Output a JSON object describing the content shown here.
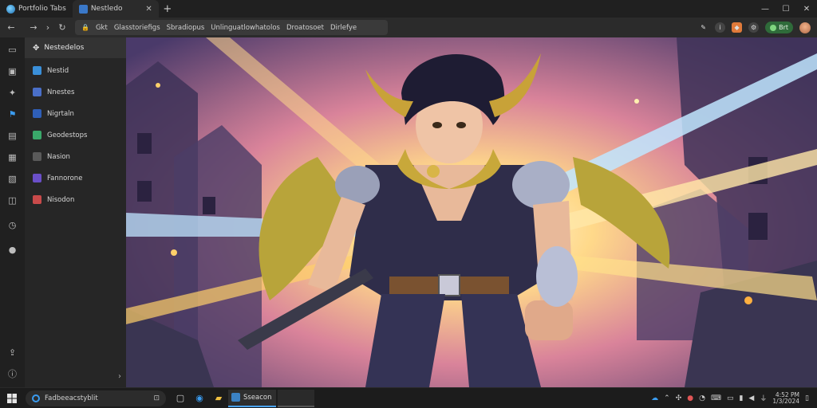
{
  "browser": {
    "tabs": [
      {
        "label": "Portfolio Tabs",
        "icon": "browser-logo-icon"
      },
      {
        "label": "Nestledo",
        "icon": "page-icon",
        "active": true
      }
    ],
    "new_tab_label": "+",
    "address": {
      "segment1": "Gkt",
      "segment2": "Glasstoriefigs",
      "segment3": "Sbradiopus",
      "segment4": "Unlinguatlowhatolos",
      "segment5": "Droatosoet",
      "segment6": "Dirlefye"
    },
    "profile_pill_label": "Brt"
  },
  "sidebar": {
    "header": "Nestedelos",
    "items": [
      {
        "label": "Nestid",
        "color": "#3a8fd9"
      },
      {
        "label": "Nnestes",
        "color": "#4a6fc8"
      },
      {
        "label": "Nigrtaln",
        "color": "#2f5fb8"
      },
      {
        "label": "Geodestops",
        "color": "#3aa86a"
      },
      {
        "label": "Nasion",
        "color": "#5a5a5a"
      },
      {
        "label": "Fannorone",
        "color": "#6a4fc8"
      },
      {
        "label": "Nisodon",
        "color": "#c84a4a"
      }
    ]
  },
  "taskbar": {
    "search_text": "Fadbeeacstyblit",
    "active_app_label": "Sseacon",
    "clock_line1": "4:52 PM",
    "clock_line2": "1/3/2024"
  }
}
